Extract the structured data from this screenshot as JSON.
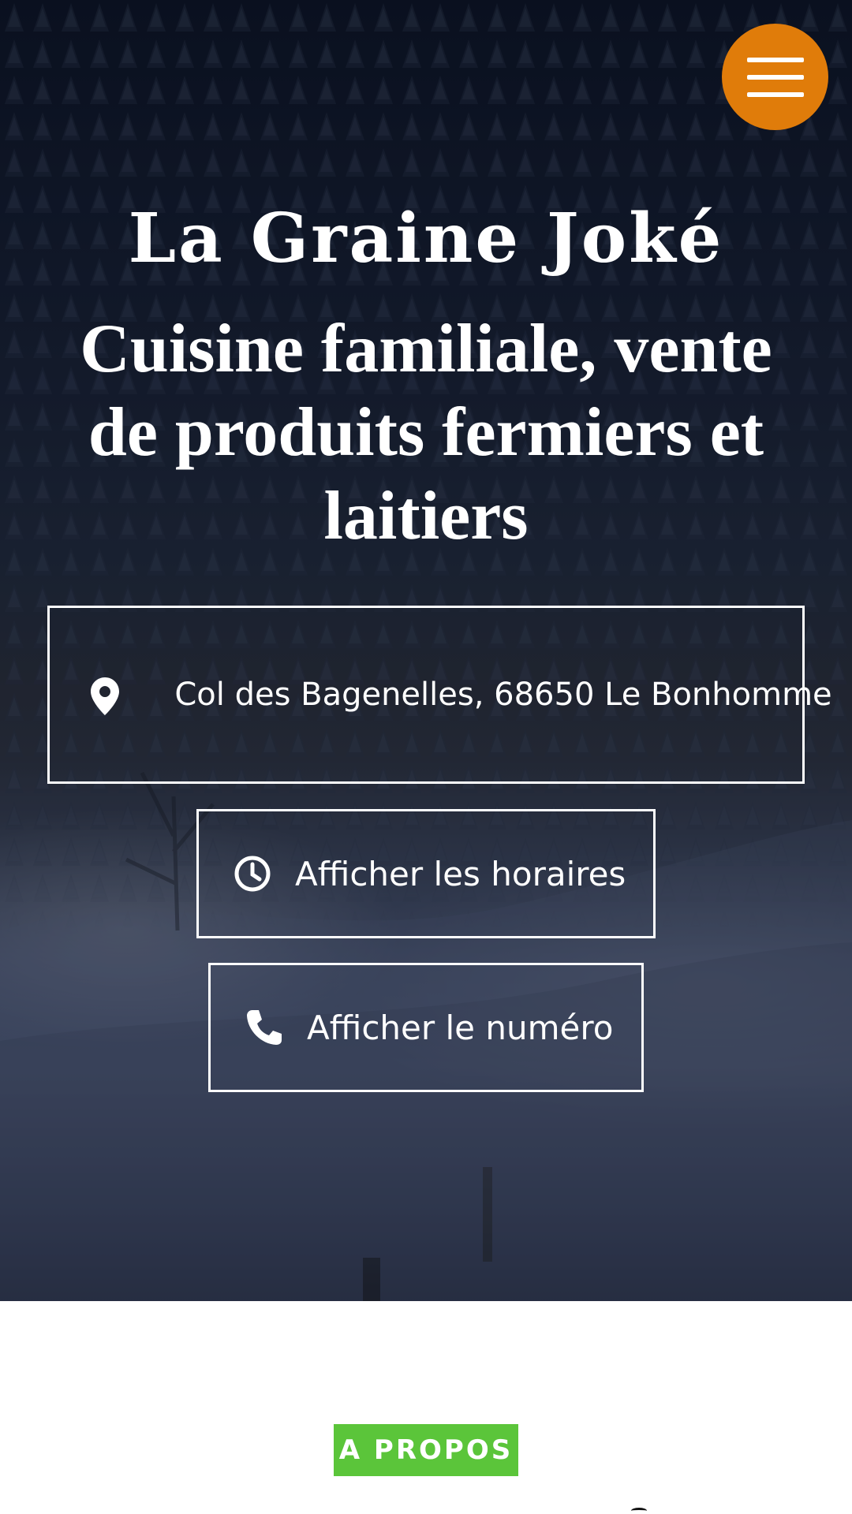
{
  "header": {
    "menu_icon": "hamburger-menu-icon",
    "menu_color": "#e07c0a"
  },
  "hero": {
    "title": "La Graine Joké",
    "tagline": "Cuisine familiale, vente de produits fermiers et laitiers",
    "address": "Col des Bagenelles, 68650 Le Bonhomme",
    "address_icon": "map-pin-icon",
    "hours_button": "Afficher les horaires",
    "hours_icon": "clock-icon",
    "phone_button": "Afficher le numéro",
    "phone_icon": "phone-icon"
  },
  "about": {
    "badge": "A PROPOS",
    "badge_color": "#5bc53a"
  }
}
